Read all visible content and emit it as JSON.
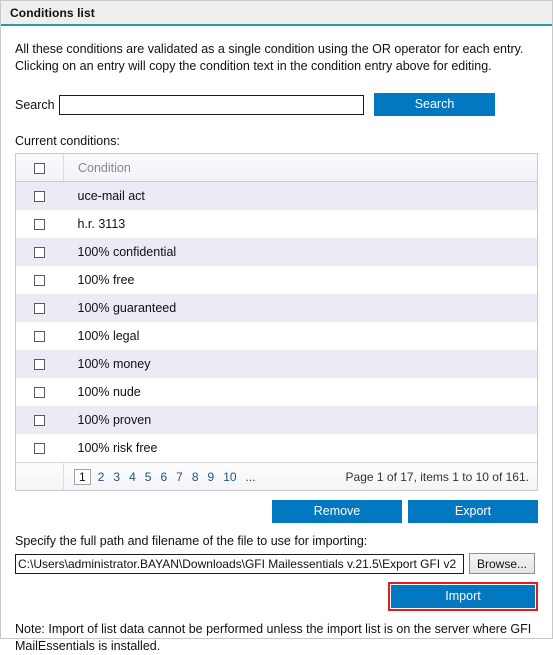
{
  "window": {
    "title": "Conditions list",
    "accent_color": "#2e9aa8",
    "button_color": "#0278c0",
    "highlight_color": "#e02020"
  },
  "intro": {
    "line1": "All these conditions are validated as a single condition using the OR operator for each entry.",
    "line2": "Clicking on an entry will copy the condition text in the condition entry above for editing."
  },
  "search": {
    "label": "Search",
    "value": "",
    "placeholder": "",
    "button_label": "Search"
  },
  "table": {
    "section_label": "Current conditions:",
    "column_header": "Condition",
    "rows": [
      {
        "condition": "uce-mail act"
      },
      {
        "condition": "h.r. 3113"
      },
      {
        "condition": "100% confidential"
      },
      {
        "condition": "100% free"
      },
      {
        "condition": "100% guaranteed"
      },
      {
        "condition": "100% legal"
      },
      {
        "condition": "100% money"
      },
      {
        "condition": "100% nude"
      },
      {
        "condition": "100% proven"
      },
      {
        "condition": "100% risk free"
      }
    ]
  },
  "pagination": {
    "pages": [
      "1",
      "2",
      "3",
      "4",
      "5",
      "6",
      "7",
      "8",
      "9",
      "10",
      "..."
    ],
    "current_page": "1",
    "info": "Page 1 of 17, items 1 to 10 of 161."
  },
  "actions": {
    "remove_label": "Remove",
    "export_label": "Export"
  },
  "import": {
    "label": "Specify the full path and filename of the file to use for importing:",
    "path_value": "C:\\Users\\administrator.BAYAN\\Downloads\\GFI Mailessentials v.21.5\\Export GFI v2",
    "path_placeholder": "",
    "browse_label": "Browse...",
    "import_label": "Import",
    "note_line1": "Note: Import of list data cannot be performed unless the import list is on the server where GFI",
    "note_line2": "MailEssentials is installed."
  }
}
